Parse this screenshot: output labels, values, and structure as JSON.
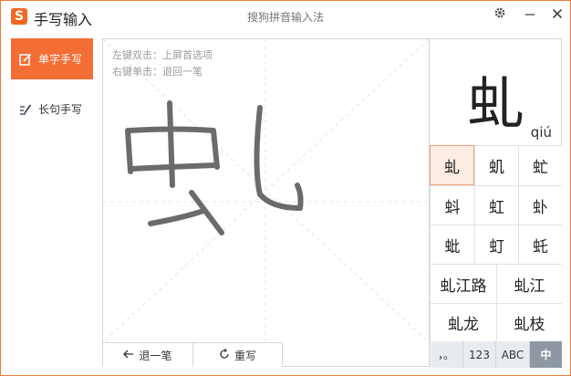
{
  "app": {
    "logo_letter": "S",
    "title": "手写输入",
    "center_title": "搜狗拼音输入法"
  },
  "titlebar": {
    "settings_icon": "gear-icon",
    "minimize_icon": "minimize-icon",
    "close_icon": "close-icon"
  },
  "sidebar": {
    "items": [
      {
        "label": "单字手写",
        "icon": "pen-box-icon",
        "active": true
      },
      {
        "label": "长句手写",
        "icon": "pen-lines-icon",
        "active": false
      }
    ]
  },
  "canvas": {
    "hint_left": "左键双击：上屏首选项",
    "hint_right": "右键单击：退回一笔",
    "undo_label": "退一笔",
    "rewrite_label": "重写",
    "ink_color": "#6b6b6b"
  },
  "result": {
    "char": "虬",
    "pinyin": "qiú"
  },
  "candidates": {
    "singles": [
      "虬",
      "虮",
      "虻",
      "蚪",
      "虹",
      "虲",
      "蚍",
      "虰",
      "虴"
    ],
    "phrases": [
      "虬江路",
      "虬江",
      "虬龙",
      "虬枝"
    ]
  },
  "modes": [
    {
      "label": "，。",
      "active": false
    },
    {
      "label": "123",
      "active": false
    },
    {
      "label": "ABC",
      "active": false
    },
    {
      "label": "中",
      "active": true
    }
  ],
  "colors": {
    "accent": "#f26e35",
    "selected_bg": "#fdece3",
    "mode_active": "#8e98a4"
  }
}
